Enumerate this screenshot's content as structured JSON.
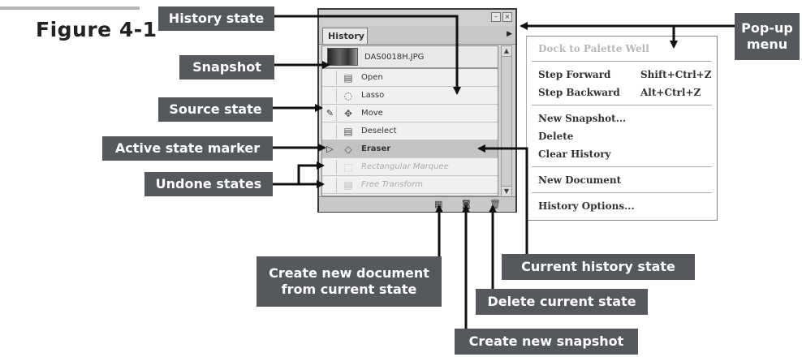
{
  "figure": {
    "label": "Figure 4-1"
  },
  "palette": {
    "tab_label": "History",
    "snapshot_name": "DAS0018H.JPG",
    "states": [
      {
        "label": "Open",
        "icon": "document-icon"
      },
      {
        "label": "Lasso",
        "icon": "lasso-icon"
      },
      {
        "label": "Move",
        "icon": "move-icon"
      },
      {
        "label": "Deselect",
        "icon": "document-icon"
      },
      {
        "label": "Eraser",
        "icon": "eraser-icon"
      },
      {
        "label": "Rectangular Marquee",
        "icon": "marquee-icon"
      },
      {
        "label": "Free Transform",
        "icon": "document-icon"
      }
    ],
    "active_state": "Eraser",
    "undone_states": [
      "Rectangular Marquee",
      "Free Transform"
    ],
    "bottom_icons": [
      "new-document-icon",
      "new-snapshot-icon",
      "trash-icon"
    ]
  },
  "menu": {
    "dock": "Dock to Palette Well",
    "step_forward": "Step Forward",
    "step_forward_shortcut": "Shift+Ctrl+Z",
    "step_backward": "Step Backward",
    "step_backward_shortcut": "Alt+Ctrl+Z",
    "new_snapshot": "New Snapshot...",
    "delete": "Delete",
    "clear_history": "Clear History",
    "new_document": "New Document",
    "history_options": "History Options..."
  },
  "callouts": {
    "history_state": "History state",
    "snapshot": "Snapshot",
    "source_state": "Source state",
    "active_state_marker": "Active state marker",
    "undone_states": "Undone states",
    "popup_menu_line1": "Pop-up",
    "popup_menu_line2": "menu",
    "create_new_document_line1": "Create new document",
    "create_new_document_line2": "from current state",
    "current_history_state": "Current history state",
    "delete_current_state": "Delete current state",
    "create_new_snapshot": "Create new snapshot"
  },
  "colors": {
    "callout_bg": "#55585d",
    "callout_text": "#ffffff"
  }
}
